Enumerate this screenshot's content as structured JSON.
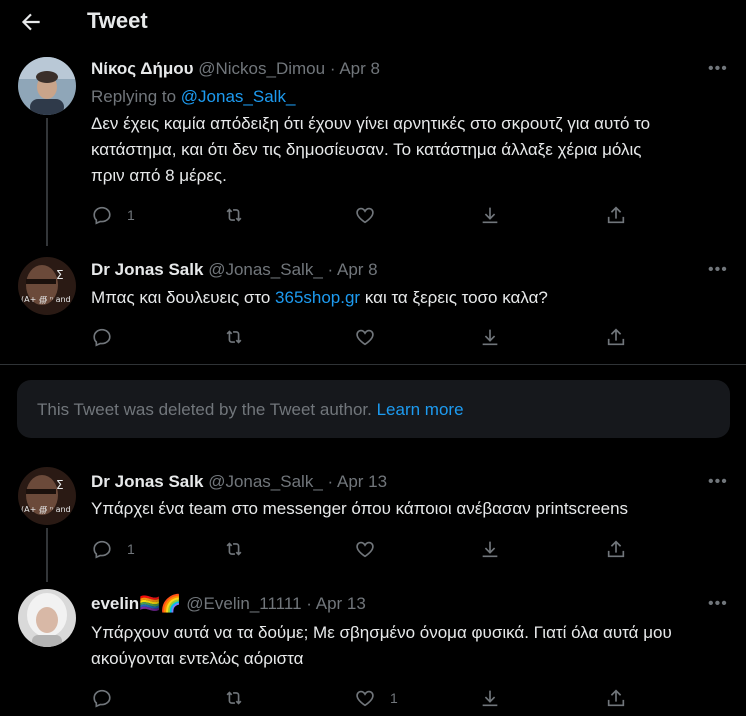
{
  "header": {
    "title": "Tweet"
  },
  "tweets": [
    {
      "name": "Νίκος Δήμου",
      "handle": "@Nickos_Dimou",
      "sep": "·",
      "date": "Apr 8",
      "replying_label": "Replying to",
      "replying_to": "@Jonas_Salk_",
      "text": "Δεν έχεις καμία απόδειξη ότι έχουν γίνει αρνητικές στο σκρουτζ για αυτό το κατάστημα, και ότι δεν τις δημοσίευσαν. Το κατάστημα άλλαξε χέρια μόλις πριν από 8 μέρες.",
      "reply_count": "1",
      "retweet_count": "",
      "like_count": "",
      "more": "•••"
    },
    {
      "name": "Dr Jonas Salk",
      "handle": "@Jonas_Salk_",
      "sep": "·",
      "date": "Apr 8",
      "text_before": "Μπας και δουλευεις στο ",
      "text_link": "365shop.gr",
      "text_after": " και τα ξερεις τοσο καλα?",
      "reply_count": "",
      "retweet_count": "",
      "like_count": "",
      "more": "•••"
    },
    {
      "name": "Dr Jonas Salk",
      "handle": "@Jonas_Salk_",
      "sep": "·",
      "date": "Apr 13",
      "text": "Υπάρχει ένα team στο messenger όπου κάποιοι ανέβασαν printscreens",
      "reply_count": "1",
      "retweet_count": "",
      "like_count": "",
      "more": "•••"
    },
    {
      "name": "evelin",
      "name_emoji": "🏳️‍🌈🌈",
      "handle": "@Evelin_11111",
      "sep": "·",
      "date": "Apr 13",
      "text": "Υπάρχουν αυτά να τα δούμε; Με σβησμένο όνομα φυσικά. Γιατί όλα αυτά μου ακούγονται εντελώς αόριστα",
      "reply_count": "",
      "retweet_count": "",
      "like_count": "1",
      "more": "•••"
    }
  ],
  "deleted_notice": {
    "text": "This Tweet was deleted by the Tweet author.",
    "link": "Learn more"
  },
  "colors": {
    "accent": "#1d9bf0",
    "muted": "#71767b",
    "background": "#000000",
    "text": "#e7e9ea"
  }
}
